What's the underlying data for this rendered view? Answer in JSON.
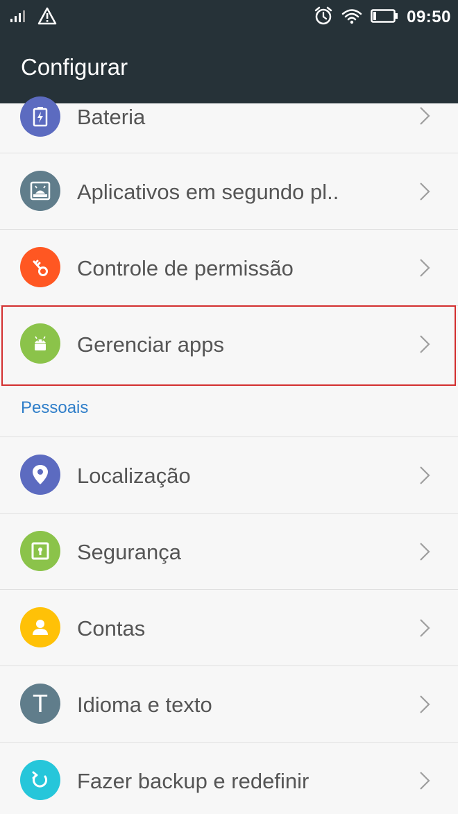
{
  "status_bar": {
    "time": "09:50",
    "icons": [
      "signal-icon",
      "warning-icon",
      "alarm-icon",
      "wifi-icon",
      "battery-icon"
    ]
  },
  "app_bar": {
    "title": "Configurar"
  },
  "colors": {
    "app_bar": "#263238",
    "section_header": "#2f7ec9",
    "highlight": "#d32f2f"
  },
  "settings_top": [
    {
      "label": "Bateria",
      "icon": "battery-icon",
      "color": "#5c6bc0"
    },
    {
      "label": "Aplicativos em segundo pl..",
      "icon": "background-apps-icon",
      "color": "#607d8b"
    },
    {
      "label": "Controle de permissão",
      "icon": "key-icon",
      "color": "#ff5722"
    },
    {
      "label": "Gerenciar apps",
      "icon": "android-icon",
      "color": "#8bc34a"
    }
  ],
  "section": {
    "label": "Pessoais"
  },
  "settings_personal": [
    {
      "label": "Localização",
      "icon": "location-icon",
      "color": "#5c6bc0"
    },
    {
      "label": "Segurança",
      "icon": "security-icon",
      "color": "#8bc34a"
    },
    {
      "label": "Contas",
      "icon": "account-icon",
      "color": "#ffc107"
    },
    {
      "label": "Idioma e texto",
      "icon": "language-icon",
      "color": "#607d8b",
      "glyph": "T"
    },
    {
      "label": "Fazer backup e redefinir",
      "icon": "backup-icon",
      "color": "#26c6da"
    }
  ]
}
